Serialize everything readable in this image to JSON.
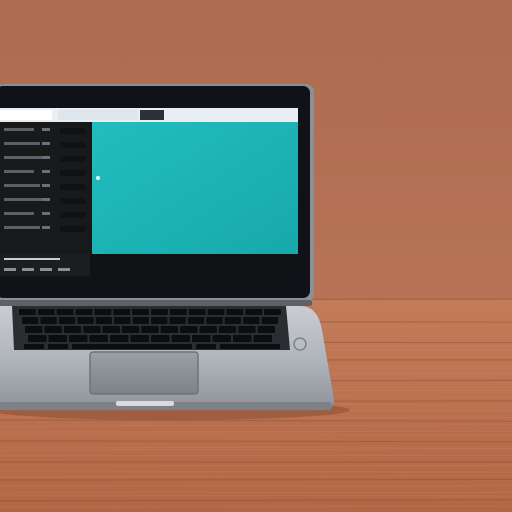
{
  "scene": {
    "subject": "laptop",
    "surface": "wooden-table"
  },
  "colors": {
    "wall": "#b9765a",
    "wall_dark": "#9f5f45",
    "table": "#b86f4f",
    "table_dark": "#8f4e33",
    "table_light": "#cc8663",
    "bezel": "#101418",
    "lid_rim": "#8b9097",
    "body_silver": "#a5aab0",
    "body_silver_light": "#c9cdd2",
    "keyboard_well": "#2a2d31",
    "key": "#0c0d0f",
    "trackpad": "#8c9197",
    "screen_main": "#1fb6b8",
    "screen_sidebar": "#161819",
    "screen_toolbar": "#e9eef2",
    "screen_taskbar": "#0f1112"
  }
}
